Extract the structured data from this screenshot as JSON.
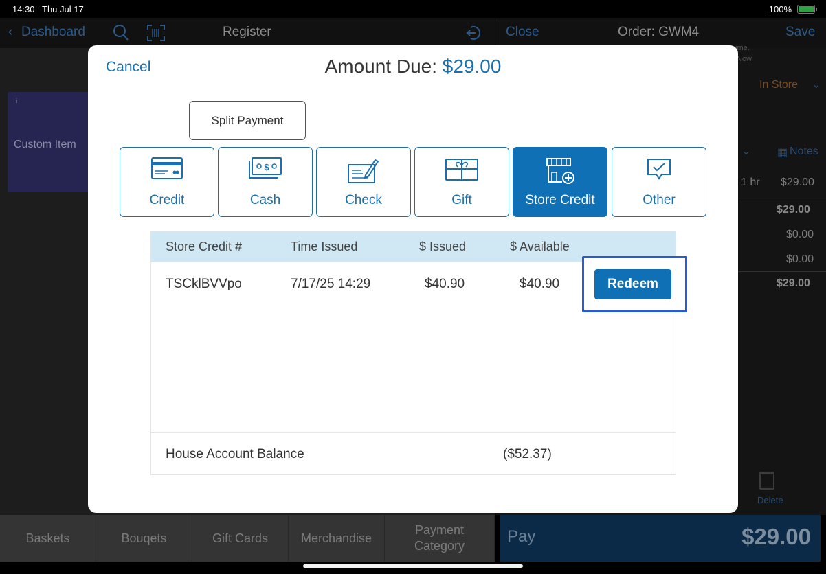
{
  "status": {
    "time": "14:30",
    "date": "Thu Jul 17",
    "battery": "100%"
  },
  "nav": {
    "back_label": "Dashboard",
    "register_title": "Register",
    "close_label": "Close",
    "order_title": "Order: GWM4",
    "save_label": "Save"
  },
  "left": {
    "custom_item_label": "Custom Item",
    "info_mark": "i"
  },
  "right": {
    "fragment_time": "ime.",
    "fragment_now": "Now",
    "fulfillment": "In Store",
    "notes_label": "Notes",
    "line_qty": "1 hr",
    "line_price": "$29.00",
    "subtotal": "$29.00",
    "discount": "$0.00",
    "tax": "$0.00",
    "total": "$29.00",
    "delete_label": "Delete"
  },
  "bottom_tabs": [
    "Baskets",
    "Bouqets",
    "Gift Cards",
    "Merchandise",
    "Payment Category"
  ],
  "pay": {
    "label": "Pay",
    "amount": "$29.00"
  },
  "modal": {
    "cancel_label": "Cancel",
    "amount_due_label": "Amount Due:",
    "amount_due": "$29.00",
    "split_payment_label": "Split Payment",
    "payment_types": [
      {
        "label": "Credit",
        "icon": "credit-card-icon",
        "active": false
      },
      {
        "label": "Cash",
        "icon": "cash-icon",
        "active": false
      },
      {
        "label": "Check",
        "icon": "check-icon",
        "active": false
      },
      {
        "label": "Gift",
        "icon": "gift-card-icon",
        "active": false
      },
      {
        "label": "Store Credit",
        "icon": "store-credit-icon",
        "active": true
      },
      {
        "label": "Other",
        "icon": "other-icon",
        "active": false
      }
    ],
    "table": {
      "headers": [
        "Store Credit #",
        "Time Issued",
        "$ Issued",
        "$ Available"
      ],
      "rows": [
        {
          "number": "TSCklBVVpo",
          "time_issued": "7/17/25 14:29",
          "issued": "$40.90",
          "available": "$40.90",
          "action": "Redeem"
        }
      ],
      "footer_label": "House Account Balance",
      "footer_value": "($52.37)"
    }
  },
  "colors": {
    "accent": "#0f70b5",
    "header_bg": "#cfe8f4",
    "highlight": "#2a5cd0"
  }
}
